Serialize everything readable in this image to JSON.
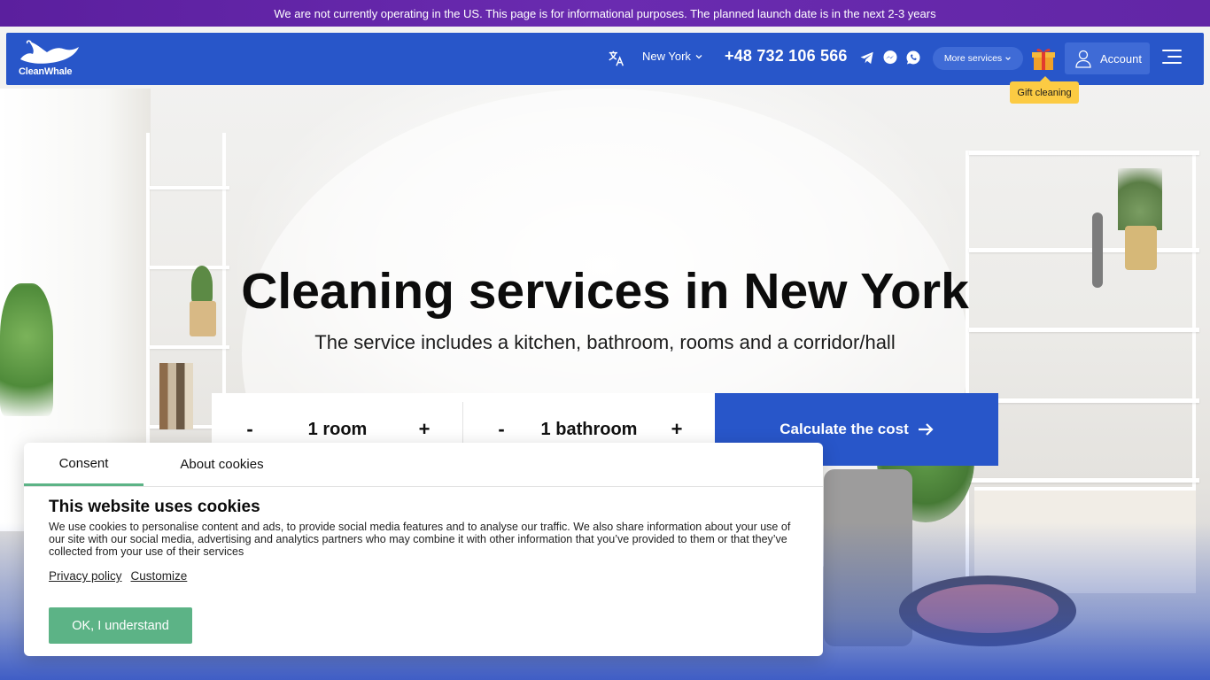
{
  "notice": {
    "text": "We are not currently operating in the US. This page is for informational purposes. The planned launch date is in the next 2-3 years"
  },
  "header": {
    "logo_text": "CleanWhale",
    "city": "New York",
    "phone": "+48 732 106 566",
    "more_services": "More services",
    "account": "Account",
    "gift_tooltip": "Gift cleaning",
    "icons": [
      "translate-icon",
      "chevron-down-icon",
      "telegram-icon",
      "messenger-icon",
      "whatsapp-icon",
      "gift-icon",
      "user-icon",
      "menu-icon"
    ]
  },
  "hero": {
    "title": "Cleaning services in New York",
    "subtitle": "The service includes a kitchen, bathroom, rooms and a corridor/hall",
    "rooms": {
      "minus": "-",
      "value": "1 room",
      "plus": "+"
    },
    "bathrooms": {
      "minus": "-",
      "value": "1 bathroom",
      "plus": "+"
    },
    "cta": "Calculate the cost"
  },
  "cookie": {
    "tabs": [
      "Consent",
      "About cookies"
    ],
    "active_tab": "Consent",
    "title": "This website uses cookies",
    "text": "We use cookies to personalise content and ads, to provide social media features and to analyse our traffic. We also share information about your use of our site with our social media, advertising and analytics partners who may combine it with other information that you’ve provided to them or that they’ve collected from your use of their services",
    "links": [
      "Privacy policy",
      "Customize"
    ],
    "ok_button": "OK, I understand"
  },
  "colors": {
    "brand_blue": "#2856c9",
    "notice_purple": "#5b1f9e",
    "accept_green": "#5cb386",
    "tooltip_yellow": "#fccb43"
  }
}
